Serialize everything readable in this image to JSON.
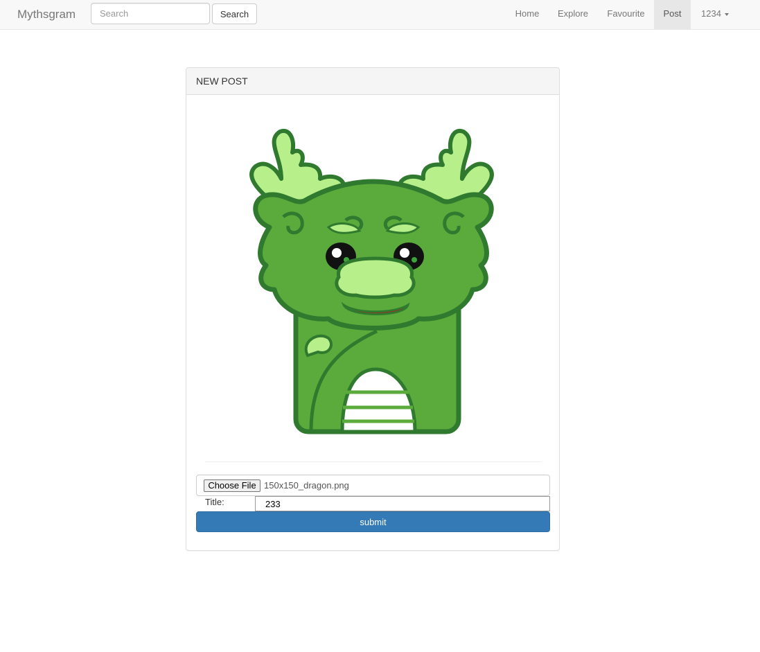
{
  "navbar": {
    "brand": "Mythsgram",
    "search": {
      "placeholder": "Search",
      "value": "",
      "button_label": "Search"
    },
    "links": {
      "home": "Home",
      "explore": "Explore",
      "favourite": "Favourite",
      "post": "Post",
      "user": "1234"
    },
    "active_link": "Post"
  },
  "panel": {
    "heading": "NEW POST",
    "preview_image": "green-dragon-mascot",
    "file_input": {
      "button_label": "Choose File",
      "file_name": "150x150_dragon.png"
    },
    "title_field": {
      "label": "Title:",
      "value": "233"
    },
    "submit_label": "submit"
  },
  "colors": {
    "primary": "#337ab7",
    "navbar_bg": "#f8f8f8",
    "active_nav_bg": "#e7e7e7",
    "dragon_dark": "#2f7a2f",
    "dragon_mid": "#5bab3c",
    "dragon_light": "#b7f08a"
  }
}
